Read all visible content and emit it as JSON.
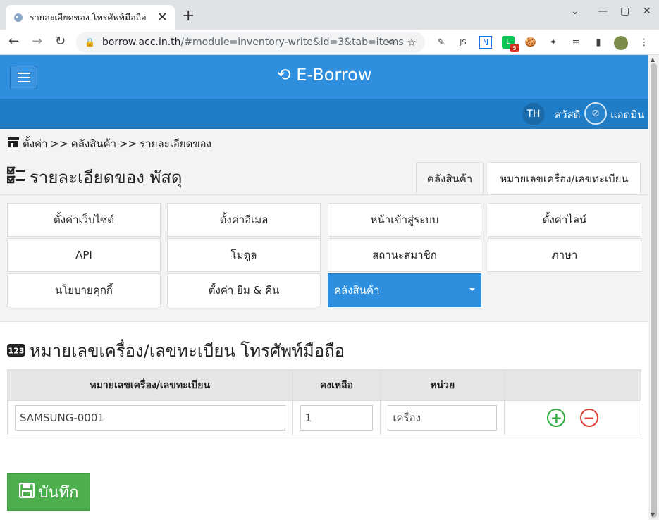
{
  "browser": {
    "tab_title": "รายละเอียดของ โทรศัพท์มือถือ",
    "url_host": "borrow.acc.in.th",
    "url_path": "/#module=inventory-write&id=3&tab=items",
    "extension_badge": "5"
  },
  "header": {
    "brand": "E-Borrow",
    "lang": "TH",
    "greeting": "สวัสดี",
    "user": "แอดมิน"
  },
  "breadcrumb": {
    "items": [
      "ตั้งค่า",
      ">>",
      "คลังสินค้า",
      ">>",
      "รายละเอียดของ"
    ]
  },
  "page": {
    "title": "รายละเอียดของ พัสดุ"
  },
  "content_tabs": [
    {
      "label": "คลังสินค้า",
      "active": false
    },
    {
      "label": "หมายเลขเครื่อง/เลขทะเบียน",
      "active": true
    }
  ],
  "settings_menu": [
    {
      "label": "ตั้งค่าเว็บไซต์"
    },
    {
      "label": "ตั้งค่าอีเมล"
    },
    {
      "label": "หน้าเข้าสู่ระบบ"
    },
    {
      "label": "ตั้งค่าไลน์"
    },
    {
      "label": "API"
    },
    {
      "label": "โมดูล"
    },
    {
      "label": "สถานะสมาชิก"
    },
    {
      "label": "ภาษา"
    },
    {
      "label": "นโยบายคุกกี้"
    },
    {
      "label": "ตั้งค่า ยืม & คืน"
    },
    {
      "label": "คลังสินค้า",
      "active": true
    }
  ],
  "section": {
    "icon": "123",
    "title": "หมายเลขเครื่อง/เลขทะเบียน โทรศัพท์มือถือ"
  },
  "table": {
    "headers": [
      "หมายเลขเครื่อง/เลขทะเบียน",
      "คงเหลือ",
      "หน่วย",
      ""
    ],
    "rows": [
      {
        "serial": "SAMSUNG-0001",
        "stock": "1",
        "unit": "เครื่อง"
      }
    ]
  },
  "actions": {
    "save_label": "บันทึก"
  },
  "colors": {
    "primary": "#2e8fde",
    "subbar": "#1f7dc7",
    "success": "#4cae4c",
    "add": "#2eaa3e",
    "remove": "#e0423a"
  }
}
